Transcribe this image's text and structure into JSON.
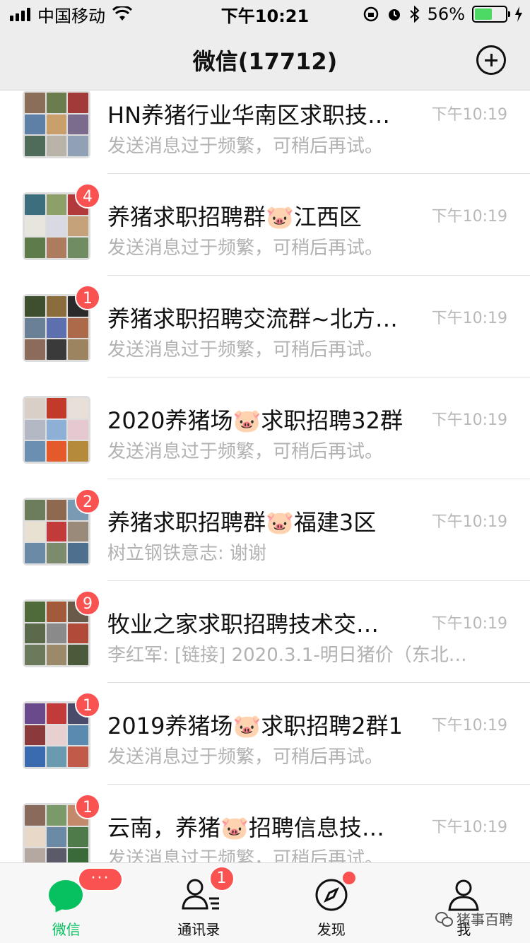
{
  "status_bar": {
    "carrier": "中国移动",
    "time": "下午10:21",
    "battery": "56%",
    "battery_level": 0.56
  },
  "nav": {
    "title": "微信(17712)",
    "add_icon": "plus-circle-icon"
  },
  "chats": [
    {
      "title": "HN养猪行业华南区求职技…",
      "preview": "发送消息过于频繁，可稍后再试。",
      "time": "下午10:19",
      "badge": "",
      "avatar_colors": [
        "#8a6e5a",
        "#6b7d4e",
        "#a33a3a",
        "#5e7fa6",
        "#c9a06b",
        "#7b6b8d",
        "#4f6b5a",
        "#b9b4a7",
        "#90a0b5"
      ]
    },
    {
      "title": "养猪求职招聘群🐷江西区",
      "preview": "发送消息过于频繁，可稍后再试。",
      "time": "下午10:19",
      "badge": "4",
      "avatar_colors": [
        "#3c6e7e",
        "#8da06a",
        "#b23a3a",
        "#e8e4de",
        "#d9d9e3",
        "#c6a27a",
        "#5d7b4b",
        "#ad7b5e",
        "#6f8c63"
      ]
    },
    {
      "title": "养猪求职招聘交流群~北方…",
      "preview": "发送消息过于频繁，可稍后再试。",
      "time": "下午10:19",
      "badge": "1",
      "avatar_colors": [
        "#3d4f2c",
        "#8b6c3c",
        "#2a2a2a",
        "#6a8096",
        "#5e6fb0",
        "#ad6a4b",
        "#8c6b5a",
        "#3a3a3a",
        "#9c8460"
      ]
    },
    {
      "title": "2020养猪场🐷求职招聘32群",
      "preview": "发送消息过于频繁，可稍后再试。",
      "time": "下午10:19",
      "badge": "",
      "avatar_colors": [
        "#d9cfc6",
        "#c23a2a",
        "#e8e0d8",
        "#b4b8c4",
        "#8cb0d6",
        "#e6c8d0",
        "#6a8fb0",
        "#e55a2a",
        "#b58a3a"
      ]
    },
    {
      "title": "养猪求职招聘群🐷福建3区",
      "preview": "树立钢铁意志: 谢谢",
      "time": "下午10:19",
      "badge": "2",
      "avatar_colors": [
        "#6b7d5a",
        "#8d6a4f",
        "#7a9ab3",
        "#e8e0d0",
        "#c23a3a",
        "#9a8a7a",
        "#6a8aa6",
        "#7b8b6b",
        "#4f6f8f"
      ]
    },
    {
      "title": "牧业之家求职招聘技术交…",
      "preview": "李红军: [链接] 2020.3.1-明日猪价（东北…",
      "time": "下午10:19",
      "badge": "9",
      "avatar_colors": [
        "#4f6b3a",
        "#a35a3a",
        "#6a5a4a",
        "#5a6a4a",
        "#8a8a8a",
        "#b24a3a",
        "#6a7a5a",
        "#9a8a6a",
        "#4a5a3a"
      ]
    },
    {
      "title": "2019养猪场🐷求职招聘2群1",
      "preview": "发送消息过于频繁，可稍后再试。",
      "time": "下午10:19",
      "badge": "1",
      "avatar_colors": [
        "#6a4a8a",
        "#c23a3a",
        "#4a4a6a",
        "#8a3a3a",
        "#e8d0d0",
        "#5a8ab0",
        "#3a6ab0",
        "#6a9ab0",
        "#c25a4a"
      ]
    },
    {
      "title": "云南，养猪🐷招聘信息技…",
      "preview": "发送消息过于频繁，可稍后再试。",
      "time": "下午10:19",
      "badge": "1",
      "avatar_colors": [
        "#8a6a5a",
        "#7a9a6a",
        "#c28a6a",
        "#e8d8c8",
        "#6a8aa6",
        "#4f7a4a",
        "#b4a8a0",
        "#5a5a6a",
        "#3a6a3a"
      ]
    }
  ],
  "tabbar": {
    "tabs": [
      {
        "label": "微信",
        "icon": "chat-bubble-icon",
        "badge": "···"
      },
      {
        "label": "通讯录",
        "icon": "contacts-icon",
        "badge": "1"
      },
      {
        "label": "发现",
        "icon": "compass-icon",
        "badge": ""
      },
      {
        "label": "我",
        "icon": "person-icon",
        "badge": ""
      }
    ],
    "watermark": "猪事百聘"
  },
  "colors": {
    "accent": "#07c160",
    "badge": "#fa5151",
    "nav_bg": "#ededed"
  }
}
